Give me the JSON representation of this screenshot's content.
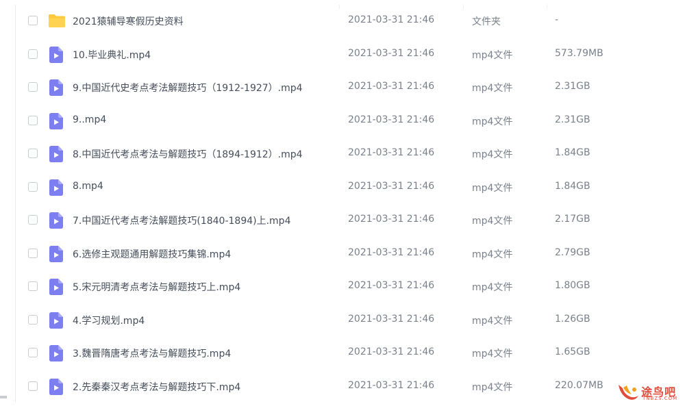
{
  "files": [
    {
      "name": "2021猿辅导寒假历史资料",
      "date": "2021-03-31 21:46",
      "type": "文件夹",
      "size": "-",
      "icon": "folder-icon"
    },
    {
      "name": "10.毕业典礼.mp4",
      "date": "2021-03-31 21:46",
      "type": "mp4文件",
      "size": "573.79MB",
      "icon": "video-file-icon"
    },
    {
      "name": "9.中国近代史考点考法解题技巧（1912-1927）.mp4",
      "date": "2021-03-31 21:46",
      "type": "mp4文件",
      "size": "2.31GB",
      "icon": "video-file-icon"
    },
    {
      "name": "9..mp4",
      "date": "2021-03-31 21:46",
      "type": "mp4文件",
      "size": "2.31GB",
      "icon": "video-file-icon"
    },
    {
      "name": "8.中国近代考点考法与解题技巧（1894-1912）.mp4",
      "date": "2021-03-31 21:46",
      "type": "mp4文件",
      "size": "1.84GB",
      "icon": "video-file-icon"
    },
    {
      "name": "8.mp4",
      "date": "2021-03-31 21:46",
      "type": "mp4文件",
      "size": "1.84GB",
      "icon": "video-file-icon"
    },
    {
      "name": "7.中国近代考点考法解题技巧(1840-1894)上.mp4",
      "date": "2021-03-31 21:46",
      "type": "mp4文件",
      "size": "2.17GB",
      "icon": "video-file-icon"
    },
    {
      "name": "6.选修主观题通用解题技巧集锦.mp4",
      "date": "2021-03-31 21:46",
      "type": "mp4文件",
      "size": "2.79GB",
      "icon": "video-file-icon"
    },
    {
      "name": "5.宋元明清考点考法与解题技巧上.mp4",
      "date": "2021-03-31 21:46",
      "type": "mp4文件",
      "size": "1.80GB",
      "icon": "video-file-icon"
    },
    {
      "name": "4.学习规划.mp4",
      "date": "2021-03-31 21:46",
      "type": "mp4文件",
      "size": "1.26GB",
      "icon": "video-file-icon"
    },
    {
      "name": "3.魏晋隋唐考点考法与解题技巧.mp4",
      "date": "2021-03-31 21:46",
      "type": "mp4文件",
      "size": "1.65GB",
      "icon": "video-file-icon"
    },
    {
      "name": "2.先秦秦汉考点考法与解题技巧下.mp4",
      "date": "2021-03-31 21:46",
      "type": "mp4文件",
      "size": "220.07MB",
      "icon": "video-file-icon"
    }
  ],
  "watermark": {
    "text": "途鸟吧",
    "subtext": "TNBZS.COM"
  },
  "colors": {
    "folder": "#ffc93c",
    "video": "#7d7ef0",
    "watermark": "#e14b3b"
  }
}
